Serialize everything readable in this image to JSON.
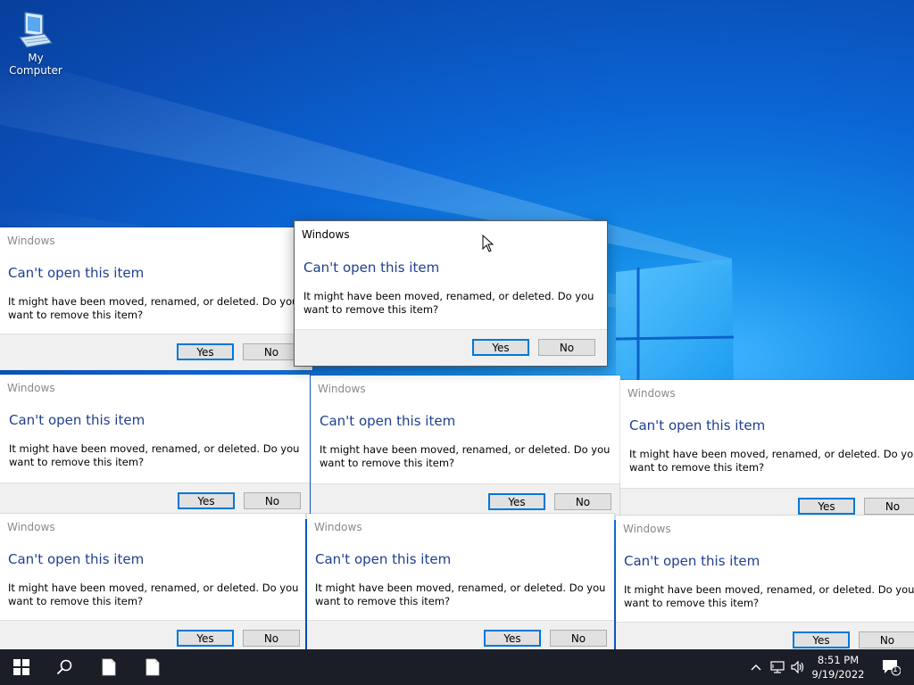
{
  "desktop": {
    "icons": [
      {
        "label": "My Computer",
        "icon": "computer-icon"
      }
    ]
  },
  "dialogs": [
    {
      "title": "Windows",
      "heading": "Can't open this item",
      "message": "It might have been moved, renamed, or deleted. Do you want to remove this item?",
      "yes_label": "Yes",
      "no_label": "No"
    },
    {
      "title": "Windows",
      "heading": "Can't open this item",
      "message": "It might have been moved, renamed, or deleted. Do you want to remove this item?",
      "yes_label": "Yes",
      "no_label": "No"
    },
    {
      "title": "Windows",
      "heading": "Can't open this item",
      "message": "It might have been moved, renamed, or deleted. Do you want to remove this item?",
      "yes_label": "Yes",
      "no_label": "No"
    },
    {
      "title": "Windows",
      "heading": "Can't open this item",
      "message": "It might have been moved, renamed, or deleted. Do you want to remove this item?",
      "yes_label": "Yes",
      "no_label": "No"
    },
    {
      "title": "Windows",
      "heading": "Can't open this item",
      "message": "It might have been moved, renamed, or deleted. Do you want to remove this item?",
      "yes_label": "Yes",
      "no_label": "No"
    },
    {
      "title": "Windows",
      "heading": "Can't open this item",
      "message": "It might have been moved, renamed, or deleted. Do you want to remove this item?",
      "yes_label": "Yes",
      "no_label": "No"
    },
    {
      "title": "Windows",
      "heading": "Can't open this item",
      "message": "It might have been moved, renamed, or deleted. Do you want to remove this item?",
      "yes_label": "Yes",
      "no_label": "No"
    },
    {
      "title": "Windows",
      "heading": "Can't open this item",
      "message": "It might have been moved, renamed, or deleted. Do you want to remove this item?",
      "yes_label": "Yes",
      "no_label": "No"
    }
  ],
  "taskbar": {
    "start_icon": "windows-logo-icon",
    "search_icon": "search-icon",
    "pinned": [
      "document-icon",
      "document-icon"
    ],
    "tray": {
      "icons": [
        "chevron-up-icon",
        "network-icon",
        "volume-icon"
      ],
      "time": "8:51 PM",
      "date": "9/19/2022",
      "notification_count": "1"
    }
  },
  "colors": {
    "accent": "#0078d7",
    "heading": "#1f3f8f",
    "taskbar": "#1b1e26"
  }
}
